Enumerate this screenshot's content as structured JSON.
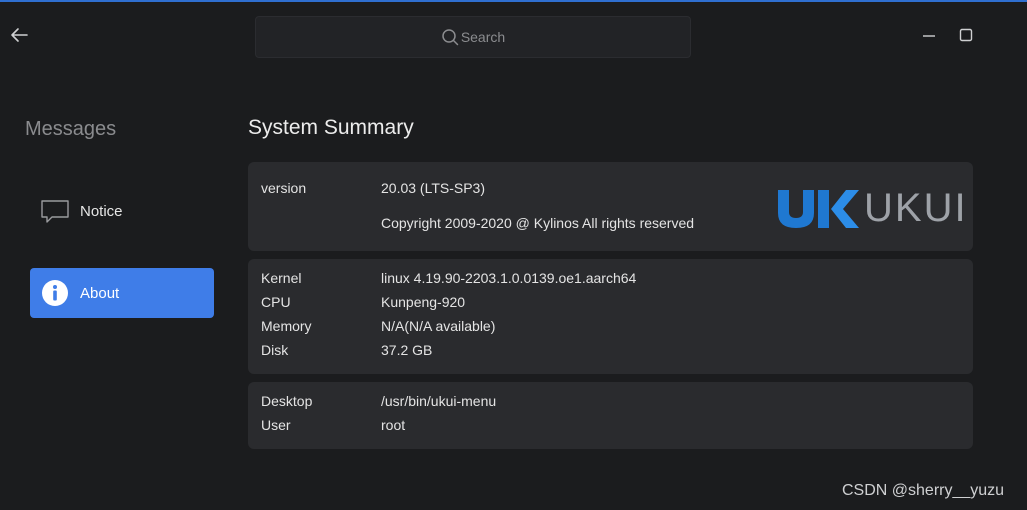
{
  "search": {
    "placeholder": "Search"
  },
  "sidebar": {
    "title": "Messages",
    "items": [
      {
        "label": "Notice",
        "icon": "message-icon",
        "selected": false
      },
      {
        "label": "About",
        "icon": "info-icon",
        "selected": true
      }
    ]
  },
  "main": {
    "title": "System Summary",
    "version": {
      "key": "version",
      "value": "20.03 (LTS-SP3)",
      "copyright": "Copyright 2009-2020 @ Kylinos All rights reserved",
      "logo_text": "UKUI"
    },
    "hardware": [
      {
        "key": "Kernel",
        "value": "linux 4.19.90-2203.1.0.0139.oe1.aarch64"
      },
      {
        "key": "CPU",
        "value": "Kunpeng-920"
      },
      {
        "key": "Memory",
        "value": "N/A(N/A available)"
      },
      {
        "key": "Disk",
        "value": "37.2 GB"
      }
    ],
    "env": [
      {
        "key": "Desktop",
        "value": "/usr/bin/ukui-menu"
      },
      {
        "key": "User",
        "value": "root"
      }
    ]
  },
  "watermark": "CSDN @sherry__yuzu",
  "colors": {
    "background": "#1b1c1e",
    "card": "#2a2b2e",
    "accent": "#3f7de8",
    "logo_blue": "#1f78d1"
  }
}
